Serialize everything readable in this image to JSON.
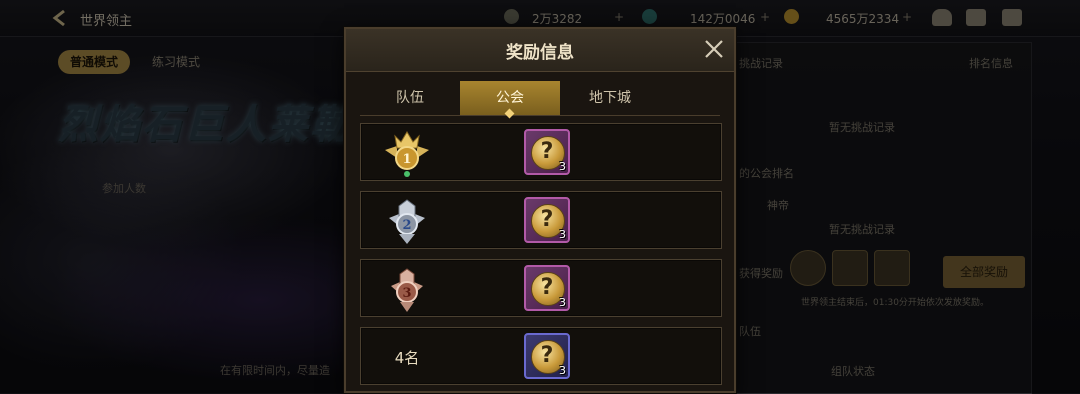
{
  "topbar": {
    "back_title": "世界领主",
    "resources": [
      "2万3282",
      "142万0046",
      "4565万2334"
    ]
  },
  "background": {
    "mode_tabs": [
      "普通模式",
      "练习模式"
    ],
    "boss_name": "烈焰石巨人莱勒",
    "join_text": "参加人数",
    "hint_text": "在有限时间内，尽量造",
    "right_panel": {
      "top_title": "挑战记录",
      "rank_info": "排名信息",
      "no_record_1": "暂无挑战记录",
      "guild_rank": "的公会排名",
      "guild_label": "神帝",
      "no_record_2": "暂无挑战记录",
      "reward_label": "获得奖励",
      "claim_all": "全部奖励",
      "notice": "世界领主结束后，01:30分开始依次发放奖励。",
      "team_label": "队伍",
      "team_status": "组队状态"
    }
  },
  "dialog": {
    "title": "奖励信息",
    "tabs": [
      {
        "label": "队伍",
        "active": false
      },
      {
        "label": "公会",
        "active": true
      },
      {
        "label": "地下城",
        "active": false
      }
    ],
    "rows": [
      {
        "rank": "1",
        "rank_label": "",
        "item_icon": "mystery-box-icon",
        "item_count": "3",
        "item_border": "purple"
      },
      {
        "rank": "2",
        "rank_label": "",
        "item_icon": "mystery-box-icon",
        "item_count": "3",
        "item_border": "purple"
      },
      {
        "rank": "3",
        "rank_label": "",
        "item_icon": "mystery-box-icon",
        "item_count": "3",
        "item_border": "purple"
      },
      {
        "rank": "4",
        "rank_label": "4名",
        "item_icon": "mystery-box-icon",
        "item_count": "3",
        "item_border": "blue"
      }
    ]
  },
  "colors": {
    "gold_accent": "#a8852f",
    "dialog_bg": "#1a1510",
    "row_border": "#4b4030",
    "purple_frame": "#b25aa8",
    "blue_frame": "#6a6ad0"
  }
}
